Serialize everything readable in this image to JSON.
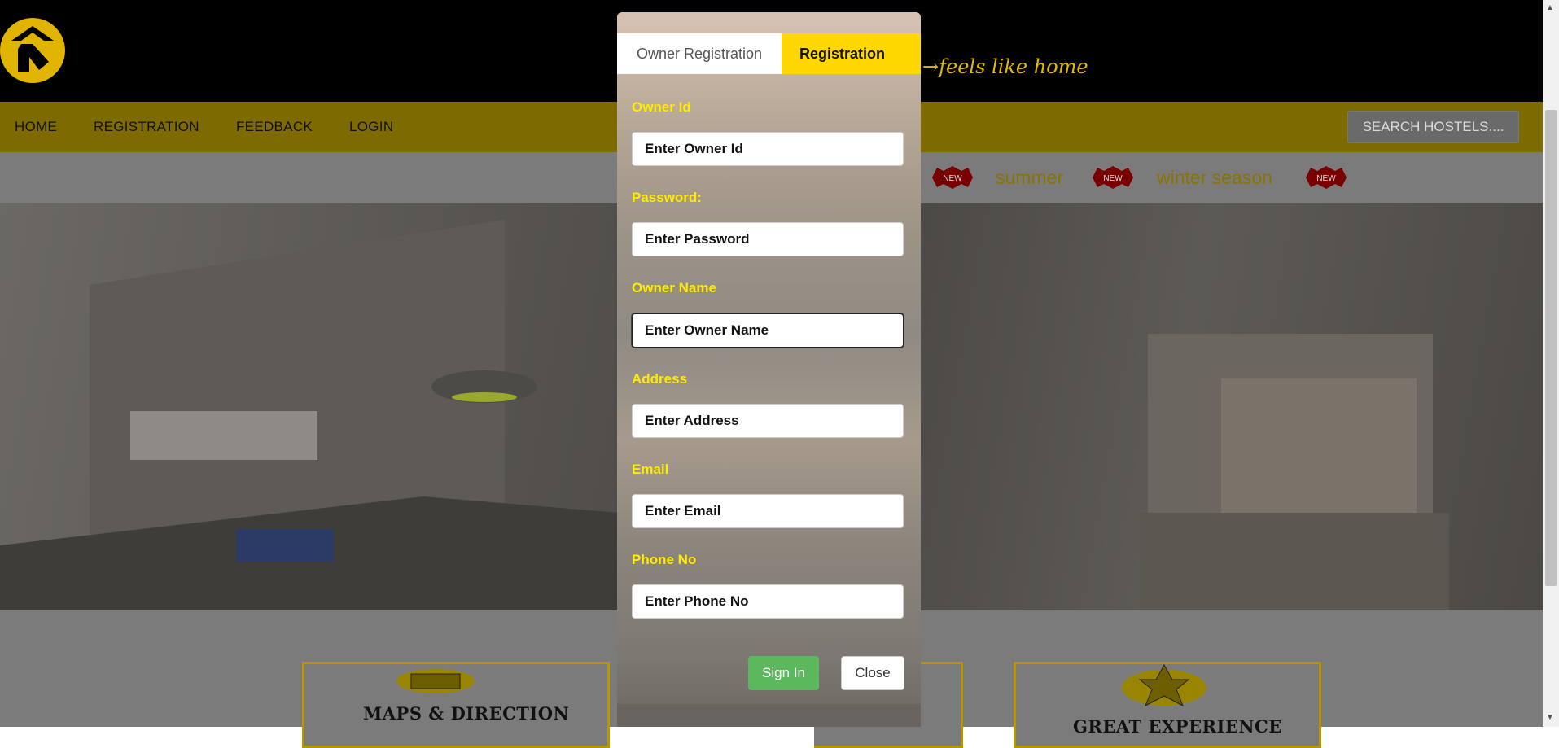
{
  "header": {
    "tagline": "→feels like home"
  },
  "nav": {
    "items": [
      {
        "label": "HOME"
      },
      {
        "label": "REGISTRATION"
      },
      {
        "label": "FEEDBACK"
      },
      {
        "label": "LOGIN"
      }
    ],
    "search_label": "SEARCH HOSTELS...."
  },
  "ticker": {
    "items": [
      "summer",
      "winter season"
    ],
    "badge": "NEW"
  },
  "cards": [
    {
      "title": "MAPS & DIRECTION"
    },
    {
      "title": "GREAT EXPERIENCE"
    }
  ],
  "modal": {
    "tabs": [
      {
        "label": "Owner Registration",
        "active": true
      },
      {
        "label": "Registration",
        "active": false
      }
    ],
    "fields": [
      {
        "label": "Owner Id",
        "placeholder": "Enter Owner Id"
      },
      {
        "label": "Password:",
        "placeholder": "Enter Password"
      },
      {
        "label": "Owner Name",
        "placeholder": "Enter Owner Name",
        "focused": true
      },
      {
        "label": "Address",
        "placeholder": "Enter Address"
      },
      {
        "label": "Email",
        "placeholder": "Enter Email"
      },
      {
        "label": "Phone No",
        "placeholder": "Enter Phone No"
      }
    ],
    "signin_label": "Sign In",
    "close_label": "Close"
  },
  "colors": {
    "accent": "#ffd800",
    "label": "#ffea00",
    "signin": "#5cb85c",
    "topbar": "#000000"
  },
  "icons": [
    "logo-icon",
    "new-badge-icon",
    "map-icon",
    "star-icon"
  ]
}
